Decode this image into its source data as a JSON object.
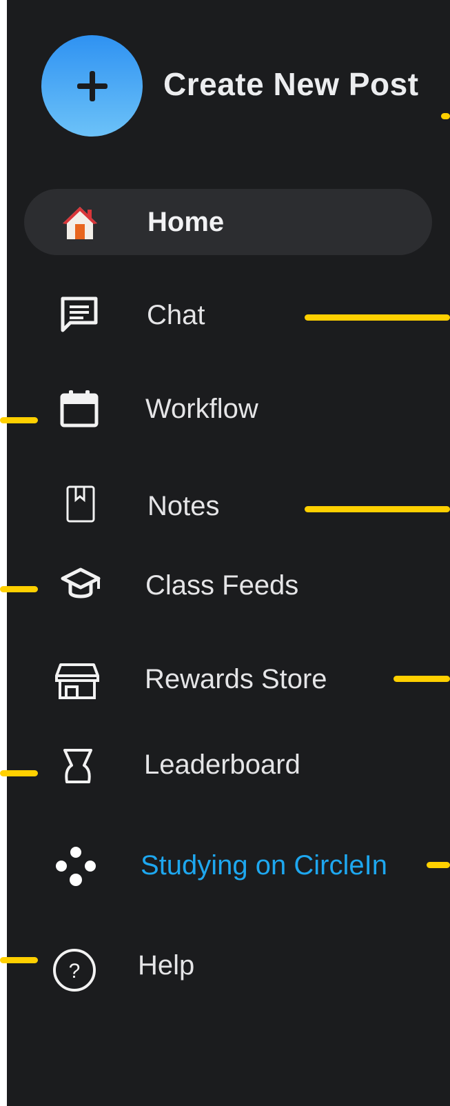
{
  "create": {
    "label": "Create New Post",
    "icon": "plus-icon"
  },
  "nav": {
    "items": [
      {
        "label": "Home",
        "icon": "home-icon",
        "active": true
      },
      {
        "label": "Chat",
        "icon": "chat-icon"
      },
      {
        "label": "Workflow",
        "icon": "calendar-icon"
      },
      {
        "label": "Notes",
        "icon": "notebook-icon"
      },
      {
        "label": "Class Feeds",
        "icon": "graduation-cap-icon"
      },
      {
        "label": "Rewards Store",
        "icon": "store-icon"
      },
      {
        "label": "Leaderboard",
        "icon": "trophy-icon"
      },
      {
        "label": "Studying on CircleIn",
        "icon": "circlein-logo-icon"
      },
      {
        "label": "Help",
        "icon": "help-circle-icon"
      }
    ]
  },
  "colors": {
    "background": "#1b1c1e",
    "active_pill": "#2c2d30",
    "accent_blue": "#1ea7ef",
    "callout_yellow": "#ffd000",
    "create_gradient": [
      "#2f92f2",
      "#6cc2f8"
    ]
  }
}
